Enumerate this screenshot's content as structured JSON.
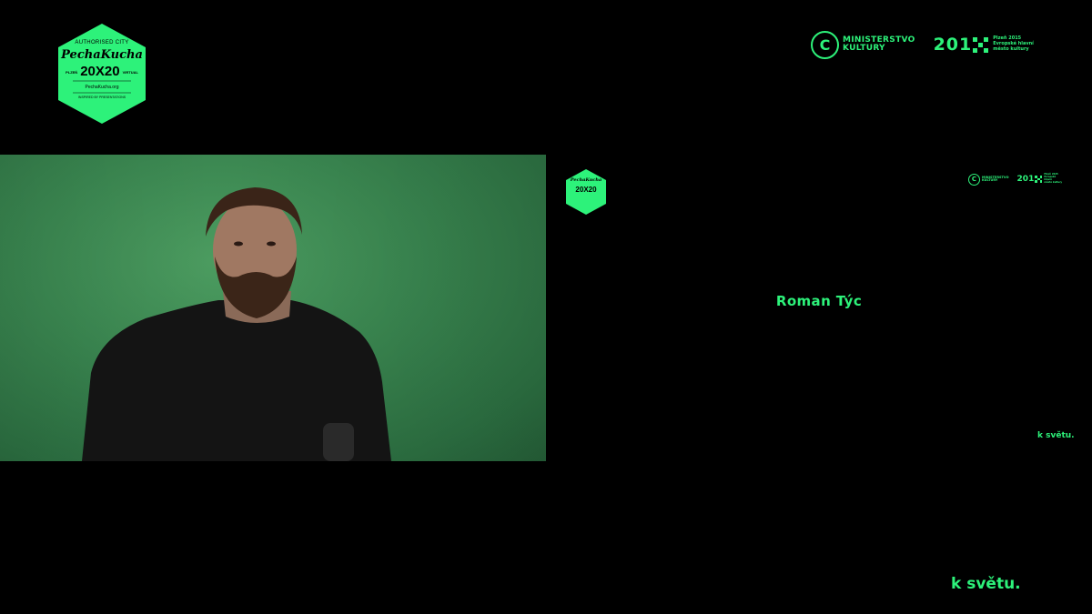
{
  "branding": {
    "main_logo": {
      "line1": "AUTHORISED CITY",
      "line2": "PechaKucha",
      "line3": "20X20",
      "line3_left": "PLZEŇ",
      "line3_right": "VIRTUAL",
      "line4": "PechaKucha.org",
      "line5": "INSPIRED BY PRESENTATIONS"
    },
    "small_logo": {
      "line1": "PechaKucha",
      "line2": "20X20"
    },
    "color_accent": "#2df27a"
  },
  "sponsors": {
    "ministry_letter": "C",
    "ministry_line1": "MINISTERSTVO",
    "ministry_line2": "KULTURY",
    "year_text": "201",
    "plzen_line1": "Plzeň 2015",
    "plzen_line2": "Evropské hlavní",
    "plzen_line3": "město kultury"
  },
  "speaker": {
    "name": "Roman Týc"
  },
  "tagline": {
    "small": "k světu.",
    "main": "k světu."
  },
  "icons": {
    "ministry": "c-circle-icon",
    "year_mark": "x-grid-icon",
    "logo": "hexagon-icon"
  }
}
